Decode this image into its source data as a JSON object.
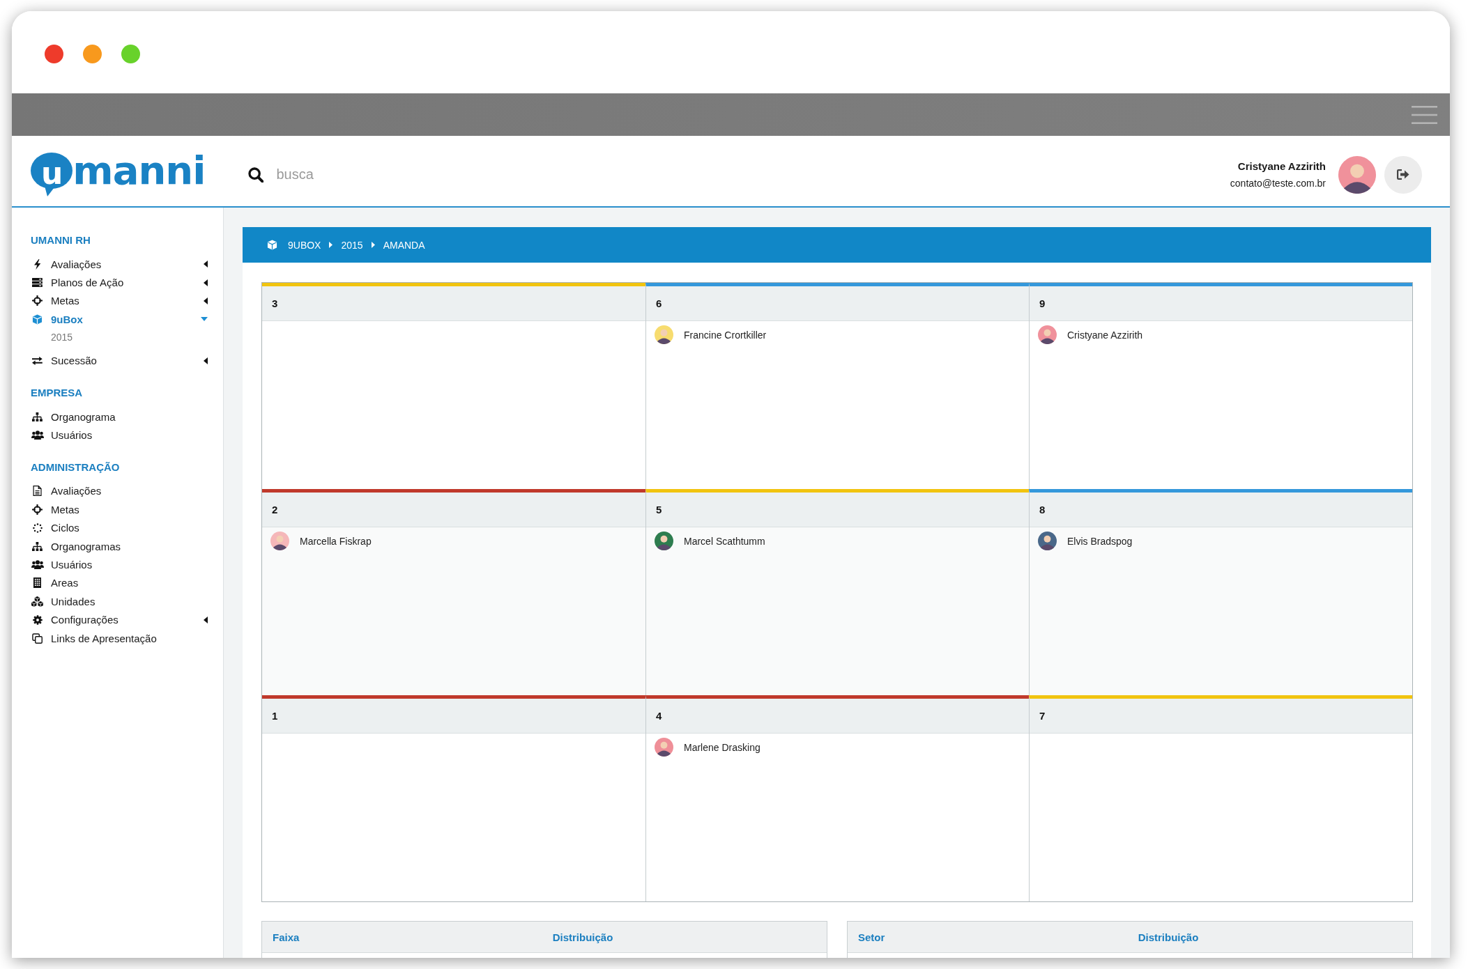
{
  "header": {
    "logo": {
      "mark": "u",
      "text": "manni"
    },
    "search": {
      "placeholder": "busca"
    },
    "user": {
      "name": "Cristyane Azzirith",
      "email": "contato@teste.com.br"
    }
  },
  "sidebar": {
    "sections": [
      {
        "title": "UMANNI RH",
        "items": [
          {
            "label": "Avaliações",
            "kind": "group",
            "expanded": false,
            "selected": false
          },
          {
            "label": "Planos de Ação",
            "kind": "group",
            "expanded": false,
            "selected": false
          },
          {
            "label": "Metas",
            "kind": "group",
            "expanded": false,
            "selected": false
          },
          {
            "label": "9uBox",
            "kind": "group",
            "expanded": true,
            "selected": true,
            "children": [
              {
                "label": "2015",
                "selected": false
              }
            ]
          },
          {
            "label": "Sucessão",
            "kind": "group",
            "expanded": false,
            "selected": false
          }
        ]
      },
      {
        "title": "EMPRESA",
        "items": [
          {
            "label": "Organograma",
            "kind": "link",
            "selected": false
          },
          {
            "label": "Usuários",
            "kind": "link",
            "selected": false
          }
        ]
      },
      {
        "title": "ADMINISTRAÇÃO",
        "items": [
          {
            "label": "Avaliações",
            "kind": "link",
            "selected": false
          },
          {
            "label": "Metas",
            "kind": "link",
            "selected": false
          },
          {
            "label": "Ciclos",
            "kind": "link",
            "selected": false
          },
          {
            "label": "Organogramas",
            "kind": "link",
            "selected": false
          },
          {
            "label": "Usuários",
            "kind": "link",
            "selected": false
          },
          {
            "label": "Areas",
            "kind": "link",
            "selected": false
          },
          {
            "label": "Unidades",
            "kind": "link",
            "selected": false
          },
          {
            "label": "Configurações",
            "kind": "group",
            "expanded": false,
            "selected": false
          },
          {
            "label": "Links de Apresentação",
            "kind": "link",
            "selected": false
          }
        ]
      }
    ]
  },
  "breadcrumb": [
    "9UBOX",
    "2015",
    "AMANDA"
  ],
  "nine_box": {
    "cells": [
      {
        "number": "3",
        "color": "#f1c40f"
      },
      {
        "number": "6",
        "color": "#3498db",
        "people": [
          {
            "name": "Francine Crortkiller",
            "color": "#f7dc6f"
          }
        ]
      },
      {
        "number": "9",
        "color": "#3498db",
        "people": [
          {
            "name": "Cristyane Azzirith",
            "color": "#f0919b"
          }
        ]
      },
      {
        "number": "2",
        "color": "#c0392b",
        "people": [
          {
            "name": "Marcella Fiskrap",
            "color": "#f5b7b9"
          }
        ]
      },
      {
        "number": "5",
        "color": "#f1c40f",
        "people": [
          {
            "name": "Marcel Scathtumm",
            "color": "#2e7d4f"
          }
        ]
      },
      {
        "number": "8",
        "color": "#3498db",
        "people": [
          {
            "name": "Elvis Bradspog",
            "color": "#4a6889"
          }
        ]
      },
      {
        "number": "1",
        "color": "#c0392b"
      },
      {
        "number": "4",
        "color": "#c0392b",
        "people": [
          {
            "name": "Marlene Drasking",
            "color": "#ef8f98"
          }
        ]
      },
      {
        "number": "7",
        "color": "#f1c40f"
      }
    ]
  },
  "tables": [
    {
      "columns": [
        "Faixa",
        "Distribuição"
      ]
    },
    {
      "columns": [
        "Setor",
        "Distribuição"
      ]
    }
  ]
}
